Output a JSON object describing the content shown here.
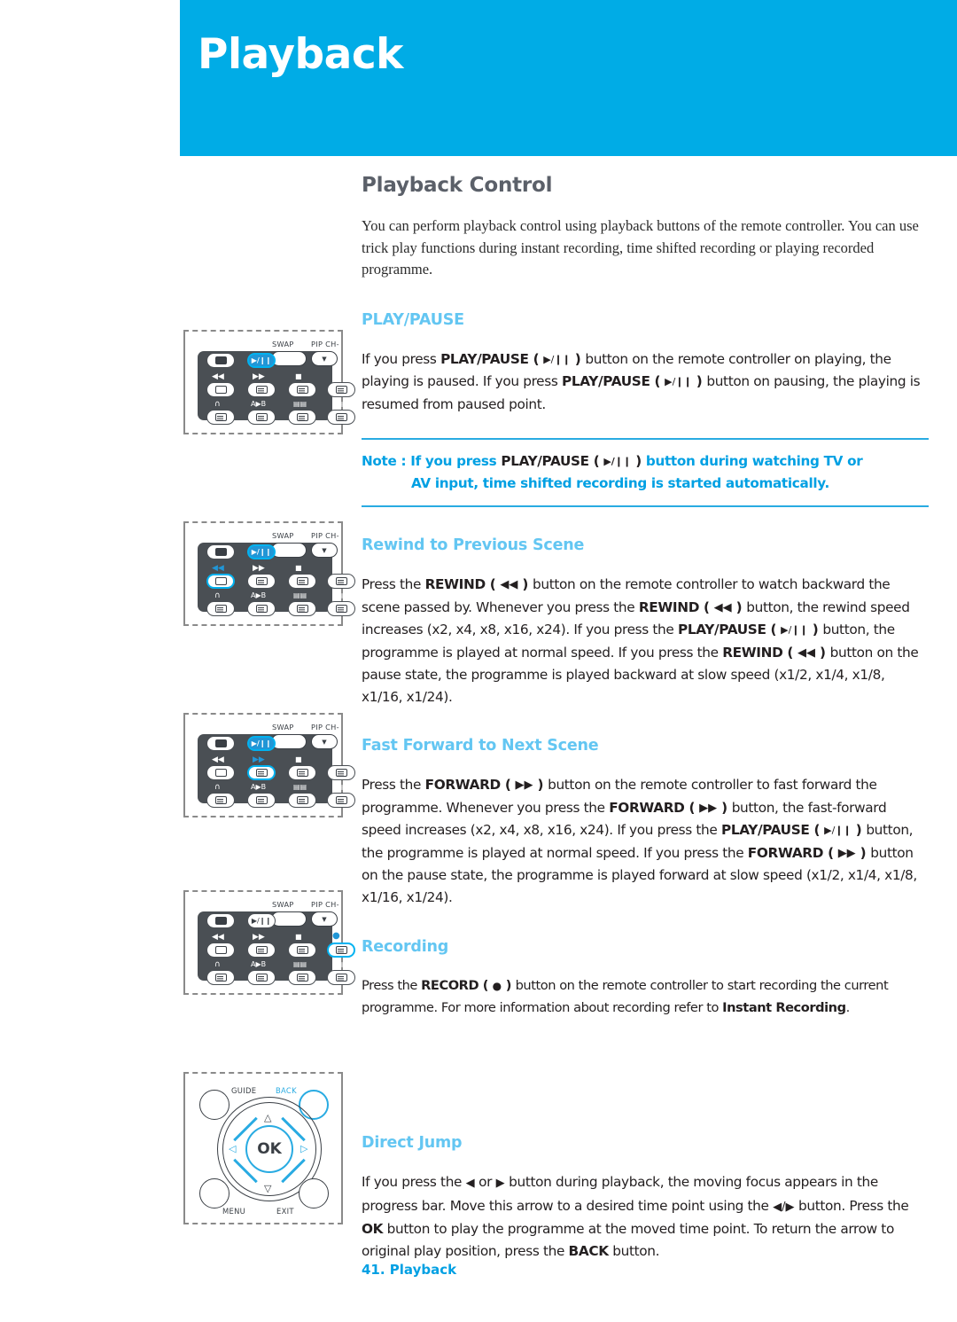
{
  "banner": {
    "title": "Playback"
  },
  "main": {
    "section_title": "Playback Control",
    "intro": "You can perform playback control using playback buttons of the remote controller. You can use trick play functions during instant recording, time shifted recording or playing recorded programme."
  },
  "sections": {
    "play_pause": {
      "heading": "PLAY/PAUSE",
      "para_1": "If you press ",
      "bold_1": "PLAY/PAUSE",
      "paren_open": " ( ",
      "icon_playpause": "▶/❙❙",
      "paren_close": " ) ",
      "para_2": "button on the remote controller on playing, the playing is paused. If you press ",
      "bold_2": "PLAY/PAUSE",
      "para_3": "button on pausing, the playing is resumed from paused point."
    },
    "note": {
      "label": "Note : If you press ",
      "bold": "PLAY/PAUSE",
      "paren_open": " ( ",
      "icon": "▶/❙❙",
      "paren_close": " ) ",
      "line1_tail": "button during watching TV or",
      "line2": "AV input, time shifted recording is started automatically."
    },
    "rewind": {
      "heading": "Rewind to Previous Scene",
      "t1": "Press the ",
      "b1": "REWIND",
      "i1": "◀◀",
      "t2": "button on the remote controller to watch backward the scene passed by. Whenever you press the ",
      "b2": "REWIND",
      "t3": "button, the rewind speed increases (x2, x4, x8, x16, x24). If you press the ",
      "b3": "PLAY/PAUSE",
      "i3": "▶/❙❙",
      "t4": "button, the programme is played at normal speed. If you press the ",
      "b4": "REWIND",
      "t5": "button on the pause state, the programme is played backward at slow speed (x1/2, x1/4, x1/8, x1/16, x1/24)."
    },
    "forward": {
      "heading": "Fast Forward to Next Scene",
      "t1": "Press the ",
      "b1": "FORWARD",
      "i1": "▶▶",
      "t2": "button on the remote controller to fast forward the programme. Whenever you press the ",
      "b2": "FORWARD",
      "t3": "button, the fast-forward speed increases (x2, x4, x8, x16, x24). If you press the ",
      "b3": "PLAY/PAUSE",
      "i3": "▶/❙❙",
      "t4": "button, the programme is played at normal speed. If you press the ",
      "b4": "FORWARD",
      "t5": "button on the pause state, the programme is played forward at slow speed (x1/2, x1/4, x1/8, x1/16, x1/24)."
    },
    "recording": {
      "heading": "Recording",
      "t1": "Press the ",
      "b1": "RECORD",
      "i1": "●",
      "t2": "button on the remote controller to start recording the current programme. For more information about recording refer to ",
      "b2": "Instant Recording",
      "t3": "."
    },
    "direct_jump": {
      "heading": "Direct Jump",
      "t1": "If you press the ",
      "i1": "◀",
      "t2": " or ",
      "i2": "▶",
      "t3": " button during playback, the moving focus appears in the progress bar. Move this arrow to a desired time point using the ",
      "i3": "◀/▶",
      "t4": " button. Press the ",
      "b1": "OK",
      "t5": " button to play the programme at the moved time point. To return the arrow to original play position, press the ",
      "b2": "BACK",
      "t6": " button."
    }
  },
  "remote": {
    "swap_label": "SWAP",
    "pip_label": "PIP CH-",
    "pip_icon": "▼",
    "transport": {
      "rewind": "◀◀",
      "forward": "▶▶",
      "stop": "■",
      "record": "●",
      "headphone": "∩",
      "ab": "A▶B",
      "book": "▤▤",
      "subtitle": "⇥▤"
    },
    "playpause_icon": "▶/❙❙"
  },
  "navpad": {
    "guide": "GUIDE",
    "back": "BACK",
    "menu": "MENU",
    "exit": "EXIT",
    "ok": "OK",
    "up": "△",
    "down": "▽",
    "left": "◁",
    "right": "▷"
  },
  "footer": {
    "text": "41. Playback"
  },
  "colors": {
    "banner_blue": "#00ace6",
    "heading_blue": "#63c6f2",
    "note_blue": "#00a0e3",
    "remote_dark": "#4a4f54",
    "highlight": "#00b2f0"
  }
}
